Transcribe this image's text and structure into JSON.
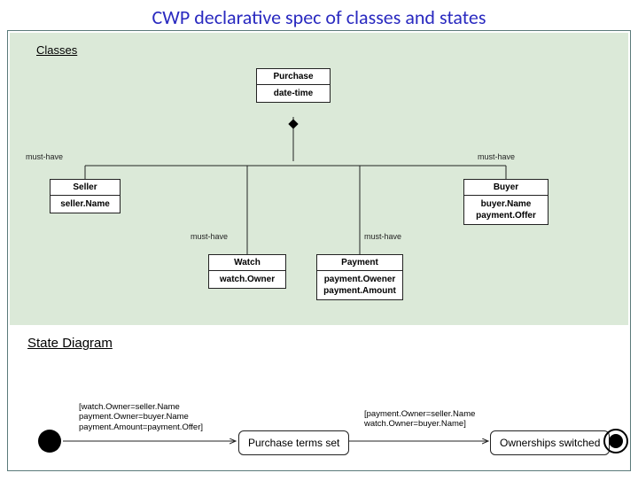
{
  "title": "CWP declarative spec of classes and states",
  "sections": {
    "classes": "Classes",
    "state": "State Diagram"
  },
  "classes": {
    "purchase": {
      "name": "Purchase",
      "attr": "date-time"
    },
    "seller": {
      "name": "Seller",
      "attr": "seller.Name"
    },
    "buyer": {
      "name": "Buyer",
      "attrs": "buyer.Name\npayment.Offer"
    },
    "watch": {
      "name": "Watch",
      "attr": "watch.Owner"
    },
    "payment": {
      "name": "Payment",
      "attrs": "payment.Owener\npayment.Amount"
    }
  },
  "assoc": {
    "musthave": "must-have"
  },
  "states": {
    "s1": "Purchase terms set",
    "s2": "Ownerships switched",
    "t1": "[watch.Owner=seller.Name\npayment.Owner=buyer.Name\npayment.Amount=payment.Offer]",
    "t2": "[payment.Owner=seller.Name\nwatch.Owner=buyer.Name]"
  }
}
